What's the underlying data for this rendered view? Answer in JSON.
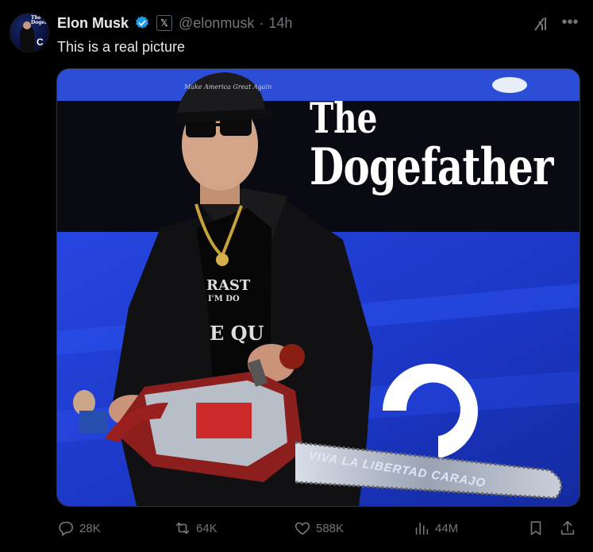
{
  "author": {
    "name": "Elon Musk",
    "handle": "@elonmusk",
    "separator": "·",
    "time": "14h",
    "verified": true,
    "affiliate_badge": "𝕏",
    "avatar_logo_text": "The Dogefa",
    "avatar_letter": "C"
  },
  "tweet": {
    "text": "This is a real picture"
  },
  "media": {
    "overlay_title_line1": "The",
    "overlay_title_line2": "Dogefather",
    "hat_text": "Make America Great Again",
    "shirt_text_1": "RAST",
    "shirt_text_2": "I'M DO",
    "shirt_text_3": "E QU",
    "chainsaw_text": "VIVA LA LIBERTAD CARAJO",
    "banner_letter": "C"
  },
  "metrics": {
    "replies": "28K",
    "reposts": "64K",
    "likes": "588K",
    "views": "44M"
  },
  "colors": {
    "background": "#000000",
    "text_primary": "#e7e9ea",
    "text_secondary": "#71767b",
    "verified_blue": "#1d9bf0",
    "stage_blue": "#1f3fd6"
  },
  "icons": {
    "grok": "grok-icon",
    "more": "more-icon",
    "reply": "reply-icon",
    "repost": "repost-icon",
    "like": "heart-icon",
    "views": "views-icon",
    "bookmark": "bookmark-icon",
    "share": "share-icon"
  }
}
